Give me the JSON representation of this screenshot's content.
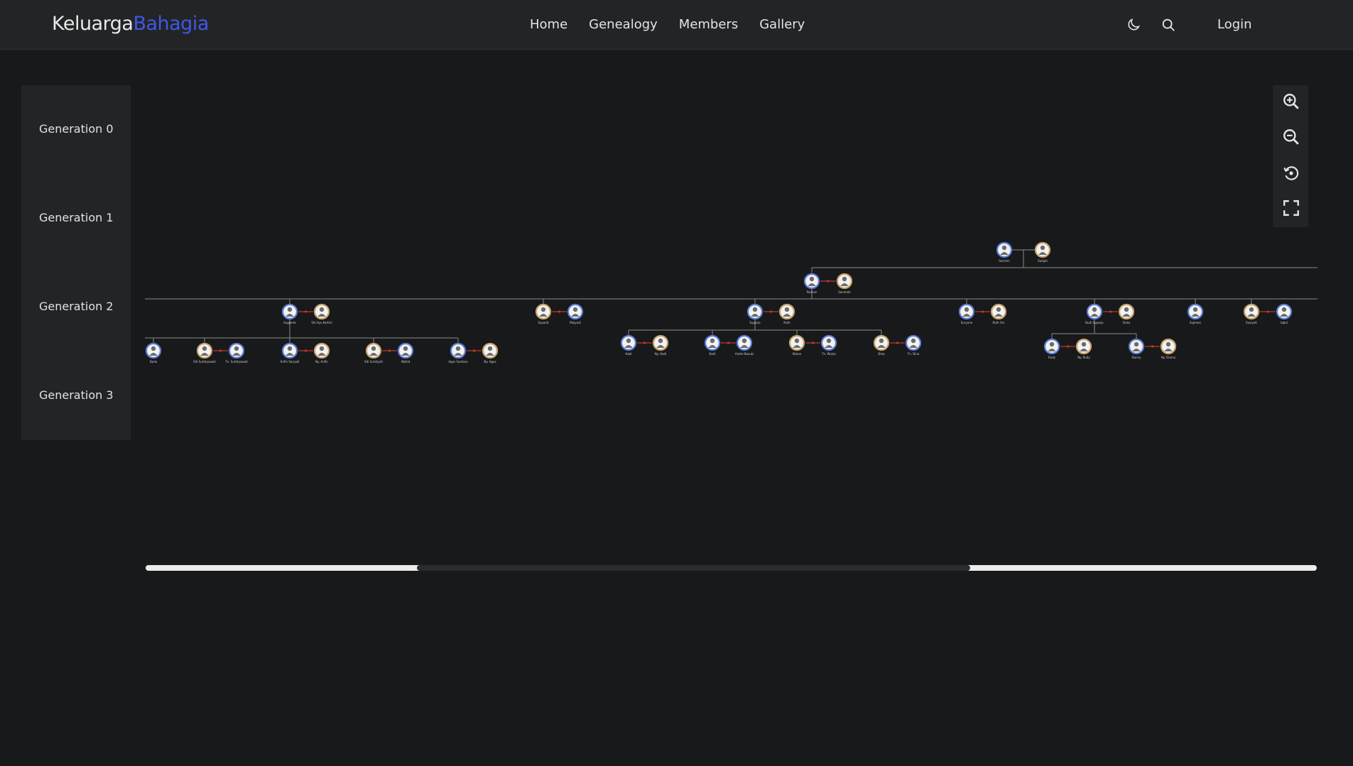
{
  "brand": {
    "part1": "Keluarga",
    "part2": "Bahagia"
  },
  "nav": {
    "items": [
      "Home",
      "Genealogy",
      "Members",
      "Gallery"
    ],
    "login": "Login"
  },
  "icons": {
    "theme": "moon-icon",
    "search": "search-icon",
    "zoom_in": "zoom-in-icon",
    "zoom_out": "zoom-out-icon",
    "reset": "reset-icon",
    "fullscreen": "fullscreen-icon"
  },
  "generations": [
    "Generation 0",
    "Generation 1",
    "Generation 2",
    "Generation 3"
  ],
  "colors": {
    "accent": "#3f57e8",
    "male_ring": "#5b7dd8",
    "female_ring": "#c9a46a",
    "spouse_link": "#c0392b"
  },
  "tree": {
    "members": [
      {
        "name": "Sarimin",
        "gender": "m"
      },
      {
        "name": "Sutijah",
        "gender": "f"
      },
      {
        "name": "Paiman",
        "gender": "m"
      },
      {
        "name": "Sanimah",
        "gender": "f"
      },
      {
        "name": "Sugianto",
        "gender": "m"
      },
      {
        "name": "Siti Ayu Kartini",
        "gender": "f"
      },
      {
        "name": "Supardi",
        "gender": "f"
      },
      {
        "name": "Mulyadi",
        "gender": "m"
      },
      {
        "name": "Suparjo",
        "gender": "m"
      },
      {
        "name": "Ruth",
        "gender": "f"
      },
      {
        "name": "Suryono",
        "gender": "m"
      },
      {
        "name": "Ruth Ani",
        "gender": "f"
      },
      {
        "name": "Budi Suparjo",
        "gender": "m"
      },
      {
        "name": "Sinta",
        "gender": "f"
      },
      {
        "name": "Sujiman",
        "gender": "m"
      },
      {
        "name": "Susiyati",
        "gender": "f"
      },
      {
        "name": "Iqbal",
        "gender": "m"
      },
      {
        "name": "Dadu",
        "gender": "m"
      },
      {
        "name": "Siti Sulistyawati",
        "gender": "f"
      },
      {
        "name": "Tn. Sulistyawati",
        "gender": "m"
      },
      {
        "name": "Arifin Saryadi",
        "gender": "m"
      },
      {
        "name": "Ny. Arifin",
        "gender": "f"
      },
      {
        "name": "Siti Sulistyati",
        "gender": "f"
      },
      {
        "name": "Wahid",
        "gender": "m"
      },
      {
        "name": "Agus Santoso",
        "gender": "m"
      },
      {
        "name": "Ny. Agus",
        "gender": "f"
      },
      {
        "name": "Hadi",
        "gender": "m"
      },
      {
        "name": "Ny. Hadi",
        "gender": "f"
      },
      {
        "name": "Dodi",
        "gender": "m"
      },
      {
        "name": "Andre Basuki",
        "gender": "m"
      },
      {
        "name": "Wulan",
        "gender": "f"
      },
      {
        "name": "Tn. Wulan",
        "gender": "m"
      },
      {
        "name": "Dina",
        "gender": "f"
      },
      {
        "name": "Tn. Dina",
        "gender": "m"
      },
      {
        "name": "Rudy",
        "gender": "m"
      },
      {
        "name": "Ny. Rudy",
        "gender": "f"
      },
      {
        "name": "Danny",
        "gender": "m"
      },
      {
        "name": "Ny. Danny",
        "gender": "f"
      }
    ]
  }
}
